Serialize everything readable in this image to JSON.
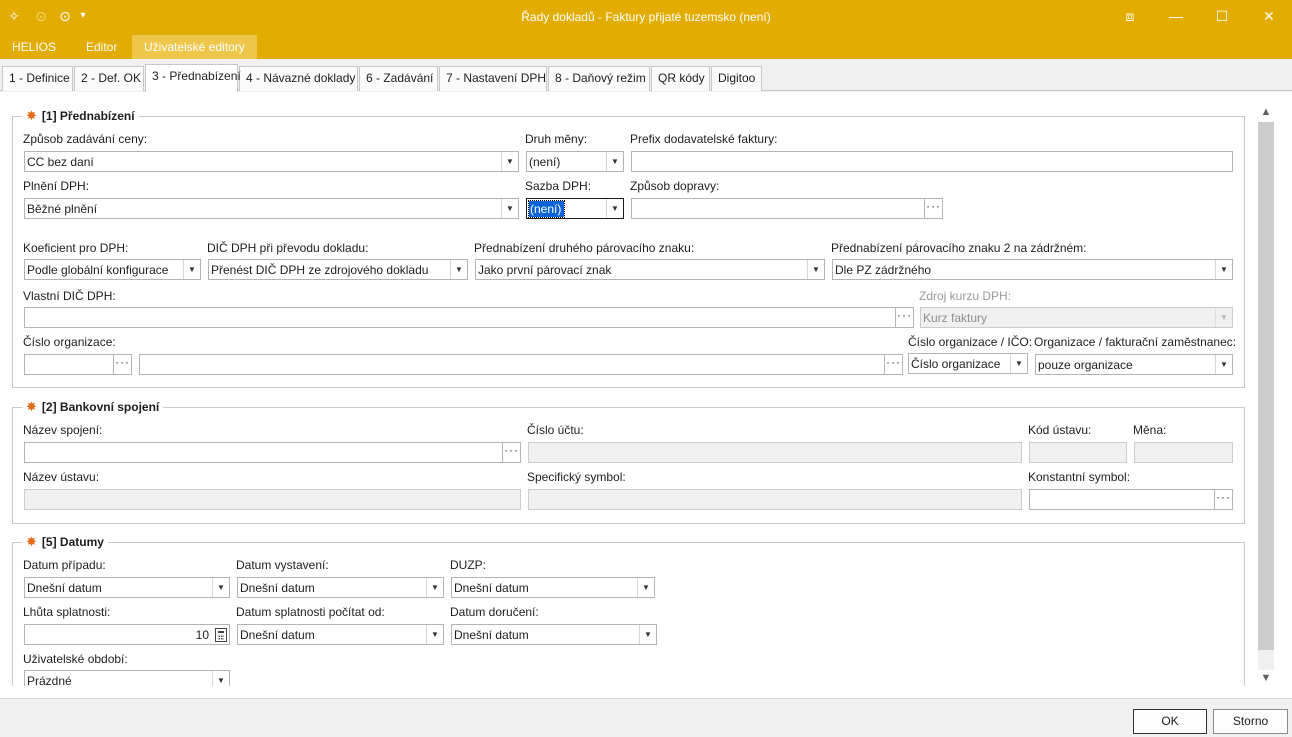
{
  "window": {
    "title": "Řady dokladů - Faktury přijaté tuzemsko (není)",
    "controls": {
      "restore": "⧈",
      "minimize": "—",
      "maximize": "☐",
      "close": "✕"
    }
  },
  "quick_icons": {
    "app": "✧",
    "back": "⊙",
    "forward": "⊙",
    "more": "▾"
  },
  "menu": {
    "helios": "HELIOS",
    "editor": "Editor",
    "user_editors": "Uživatelské editory"
  },
  "tabs": {
    "t1": "1 - Definice",
    "t2": "2 - Def. OK",
    "t3": "3 - Přednabízení",
    "t4": "4 - Návazné doklady",
    "t6": "6 - Zadávání",
    "t7": "7 - Nastavení DPH",
    "t8": "8 - Daňový režim",
    "tqr": "QR kódy",
    "tdig": "Digitoo"
  },
  "symbols": {
    "dropdown": "▼",
    "browse": "···",
    "scroll_up": "▲",
    "scroll_down": "▼",
    "group_icon": "✸"
  },
  "group1": {
    "title": "[1] Přednabízení",
    "price_mode": {
      "label": "Způsob zadávání ceny:",
      "value": "CC bez daní"
    },
    "currency_type": {
      "label": "Druh měny:",
      "value": "(není)"
    },
    "supplier_prefix": {
      "label": "Prefix dodavatelské faktury:",
      "value": ""
    },
    "vat_fulfillment": {
      "label": "Plnění DPH:",
      "value": "Běžné plnění"
    },
    "vat_rate": {
      "label": "Sazba DPH:",
      "value": "(není)"
    },
    "transport": {
      "label": "Způsob dopravy:",
      "value": ""
    },
    "vat_coef": {
      "label": "Koeficient pro DPH:",
      "value": "Podle globální konfigurace"
    },
    "vat_dic_transfer": {
      "label": "DIČ DPH při převodu dokladu:",
      "value": "Přenést DIČ DPH ze zdrojového dokladu"
    },
    "pairing2": {
      "label": "Přednabízení druhého párovacího znaku:",
      "value": "Jako první párovací znak"
    },
    "pairing2_hold": {
      "label": "Přednabízení párovacího znaku 2 na zádržném:",
      "value": "Dle PZ zádržného"
    },
    "own_vat_id": {
      "label": "Vlastní DIČ DPH:",
      "value": ""
    },
    "rate_source": {
      "label": "Zdroj kurzu DPH:",
      "value": "Kurz faktury"
    },
    "org_number": {
      "label": "Číslo organizace:",
      "value": ""
    },
    "org_name": {
      "value": ""
    },
    "org_ico": {
      "label": "Číslo organizace / IČO:",
      "value": "Číslo organizace"
    },
    "org_employee": {
      "label": "Organizace / fakturační zaměstnanec:",
      "value": "pouze organizace"
    }
  },
  "group2": {
    "title": "[2] Bankovní spojení",
    "conn_name": {
      "label": "Název spojení:",
      "value": ""
    },
    "account": {
      "label": "Číslo účtu:",
      "value": ""
    },
    "bank_code": {
      "label": "Kód ústavu:",
      "value": ""
    },
    "currency": {
      "label": "Měna:",
      "value": ""
    },
    "bank_name": {
      "label": "Název ústavu:",
      "value": ""
    },
    "spec_symbol": {
      "label": "Specifický symbol:",
      "value": ""
    },
    "const_symbol": {
      "label": "Konstantní symbol:",
      "value": ""
    }
  },
  "group5": {
    "title": "[5] Datumy",
    "case_date": {
      "label": "Datum případu:",
      "value": "Dnešní datum"
    },
    "issue_date": {
      "label": "Datum vystavení:",
      "value": "Dnešní datum"
    },
    "duzp": {
      "label": "DUZP:",
      "value": "Dnešní datum"
    },
    "due_days": {
      "label": "Lhůta splatnosti:",
      "value": "10"
    },
    "due_from": {
      "label": "Datum splatnosti počítat od:",
      "value": "Dnešní datum"
    },
    "delivery_date": {
      "label": "Datum doručení:",
      "value": "Dnešní datum"
    },
    "user_period": {
      "label": "Uživatelské období:",
      "value": "Prázdné"
    }
  },
  "buttons": {
    "ok": "OK",
    "cancel": "Storno"
  }
}
